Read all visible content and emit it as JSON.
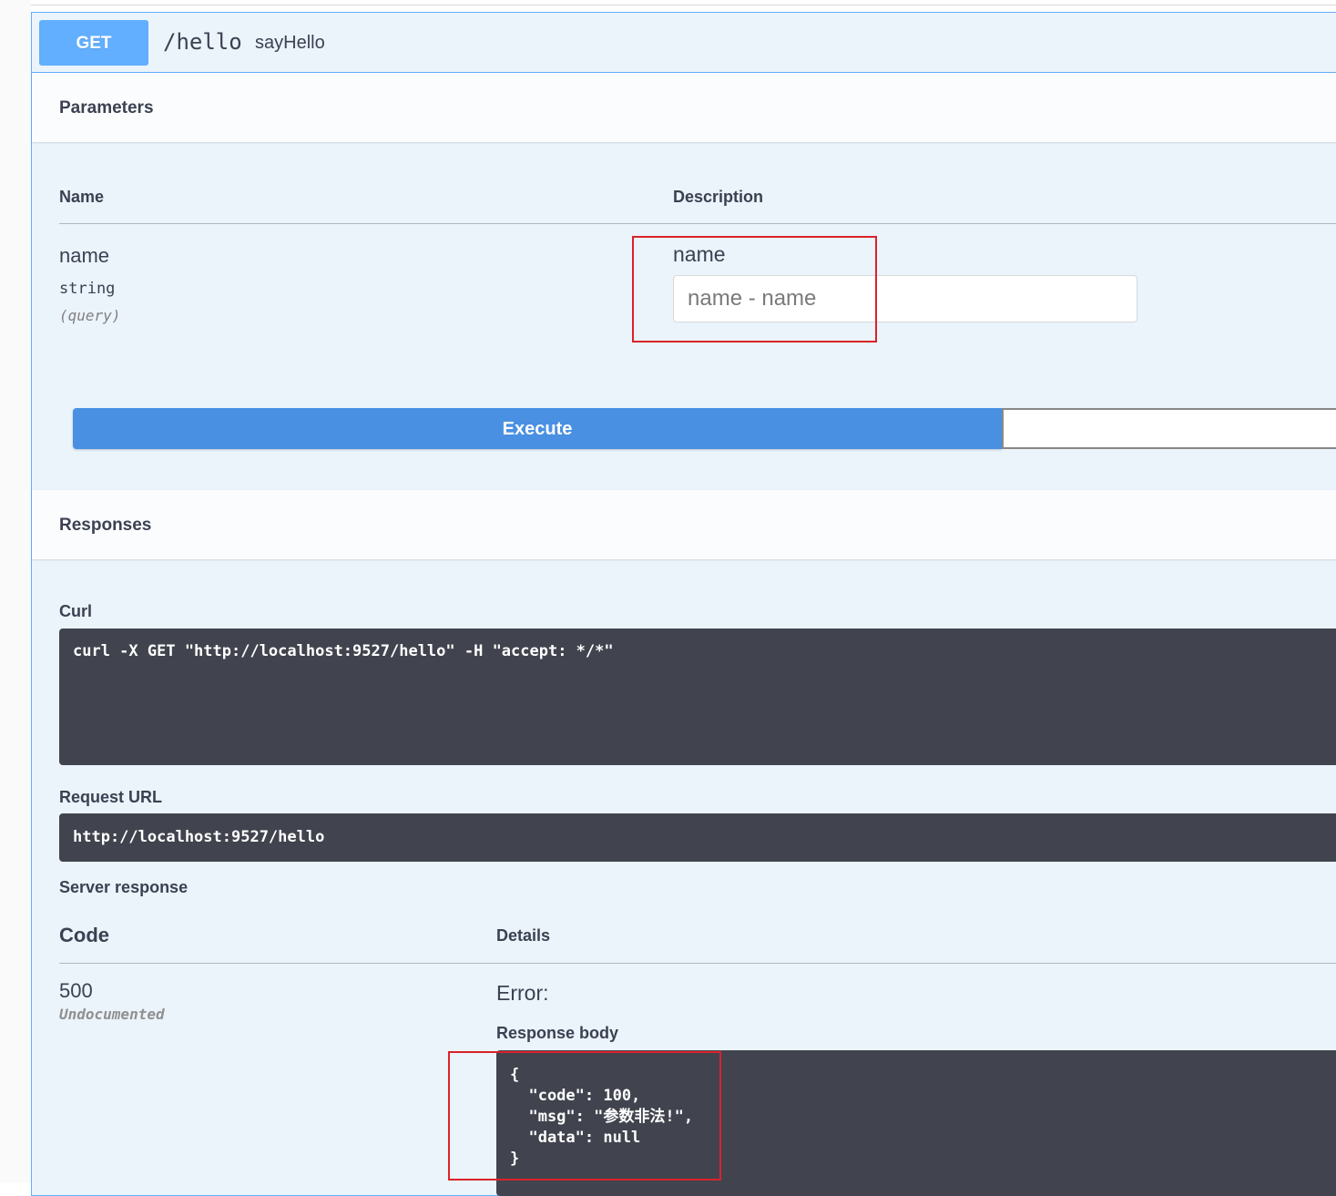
{
  "operation": {
    "method": "GET",
    "path": "/hello",
    "summary": "sayHello"
  },
  "parameters": {
    "title": "Parameters",
    "columns": {
      "name": "Name",
      "description": "Description"
    },
    "items": [
      {
        "name": "name",
        "type": "string",
        "in": "(query)",
        "description": "name",
        "placeholder": "name - name",
        "value": ""
      }
    ]
  },
  "actions": {
    "execute_label": "Execute"
  },
  "responses": {
    "title": "Responses",
    "curl_label": "Curl",
    "curl_command": "curl -X GET \"http://localhost:9527/hello\" -H \"accept: */*\"",
    "request_url_label": "Request URL",
    "request_url": "http://localhost:9527/hello",
    "server_response_label": "Server response",
    "columns": {
      "code": "Code",
      "details": "Details"
    },
    "status_code": "500",
    "status_note": "Undocumented",
    "error_label": "Error:",
    "response_body_label": "Response body",
    "response_body": "{\n  \"code\": 100,\n  \"msg\": \"参数非法!\",\n  \"data\": null\n}"
  },
  "annotations": {
    "highlight_color": "#d9232a"
  },
  "colors": {
    "get_accent": "#61affe",
    "execute": "#4990e2",
    "code_bg": "#41444e"
  }
}
